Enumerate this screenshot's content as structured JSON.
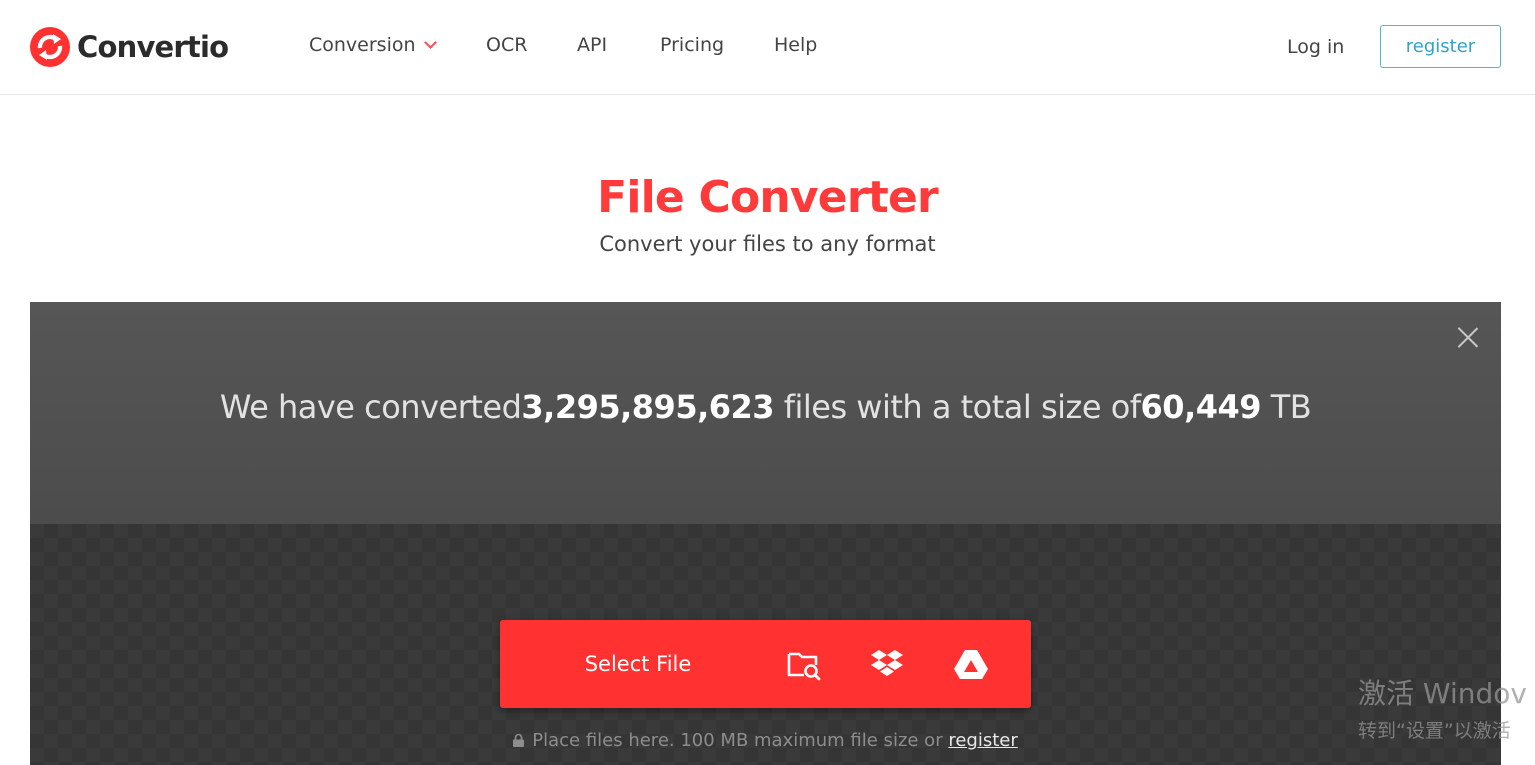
{
  "brand": {
    "name": "Convertio",
    "accent_color": "#ff3131",
    "link_color": "#2ea3cf"
  },
  "nav": {
    "items": [
      {
        "label": "Conversion",
        "has_dropdown": true
      },
      {
        "label": "OCR"
      },
      {
        "label": "API"
      },
      {
        "label": "Pricing"
      },
      {
        "label": "Help"
      }
    ],
    "login": "Log in",
    "register": "register"
  },
  "hero": {
    "title": "File Converter",
    "subtitle": "Convert your files to any format"
  },
  "stats": {
    "prefix": "We have converted",
    "files_count": "3,295,895,623",
    "middle": " files with a total size of",
    "total_size": "60,449",
    "unit": " TB"
  },
  "upload": {
    "select_label": "Select File",
    "sources": [
      {
        "icon": "folder-search-icon"
      },
      {
        "icon": "dropbox-icon"
      },
      {
        "icon": "google-drive-icon"
      }
    ],
    "note": "Place files here. 100 MB maximum file size or ",
    "note_link": "register"
  },
  "watermark": {
    "line1": "激活 Windov",
    "line2": "转到“设置”以激活"
  }
}
